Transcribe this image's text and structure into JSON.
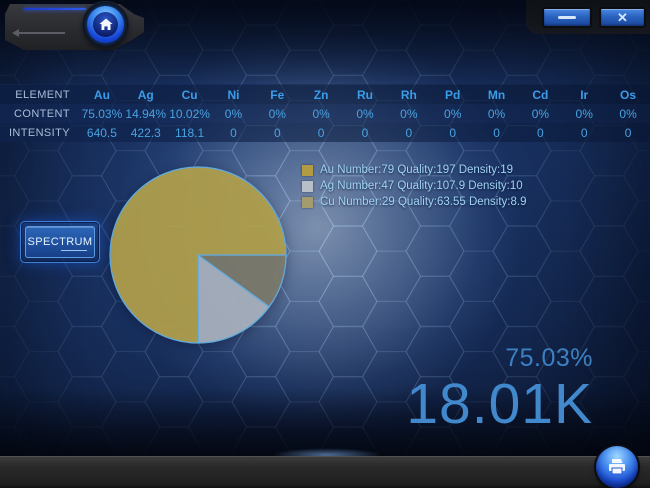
{
  "window": {
    "controls": {
      "close_glyph": "✕"
    }
  },
  "element_table": {
    "row_labels": [
      "ELEMENT",
      "CONTENT",
      "INTENSITY"
    ],
    "columns": [
      {
        "element": "Au",
        "content": "75.03%",
        "intensity": "640.5"
      },
      {
        "element": "Ag",
        "content": "14.94%",
        "intensity": "422.3"
      },
      {
        "element": "Cu",
        "content": "10.02%",
        "intensity": "118.1"
      },
      {
        "element": "Ni",
        "content": "0%",
        "intensity": "0"
      },
      {
        "element": "Fe",
        "content": "0%",
        "intensity": "0"
      },
      {
        "element": "Zn",
        "content": "0%",
        "intensity": "0"
      },
      {
        "element": "Ru",
        "content": "0%",
        "intensity": "0"
      },
      {
        "element": "Rh",
        "content": "0%",
        "intensity": "0"
      },
      {
        "element": "Pd",
        "content": "0%",
        "intensity": "0"
      },
      {
        "element": "Mn",
        "content": "0%",
        "intensity": "0"
      },
      {
        "element": "Cd",
        "content": "0%",
        "intensity": "0"
      },
      {
        "element": "Ir",
        "content": "0%",
        "intensity": "0"
      },
      {
        "element": "Os",
        "content": "0%",
        "intensity": "0"
      }
    ]
  },
  "legend": {
    "items": [
      {
        "element": "Au",
        "text": "Au Number:79 Quality:197 Density:19",
        "swatch_color": "#b19b43"
      },
      {
        "element": "Ag",
        "text": "Ag Number:47 Quality:107.9 Density:10",
        "swatch_color": "#b7c0c9"
      },
      {
        "element": "Cu",
        "text": "Cu Number:29 Quality:63.55 Density:8.9",
        "swatch_color": "#a59c6d"
      }
    ]
  },
  "spectrum_button": {
    "label": "SPECTRUM"
  },
  "summary": {
    "content_percent": "75.03%",
    "total_intensity": "18.01K"
  },
  "chart_data": {
    "type": "pie",
    "title": "",
    "series": [
      {
        "name": "Au",
        "value": 75.03,
        "color": "#b2a04c"
      },
      {
        "name": "Ag",
        "value": 14.94,
        "color": "#aab3c0"
      },
      {
        "name": "Cu",
        "value": 10.02,
        "color": "#7d7b6d"
      }
    ],
    "draw_order": [
      "Cu",
      "Ag",
      "Au"
    ],
    "start_angle_deg_from_east": 0,
    "direction": "clockwise",
    "slice_stroke_color": "#62aadd",
    "legend_position": "top-right",
    "labels_shown": false
  }
}
